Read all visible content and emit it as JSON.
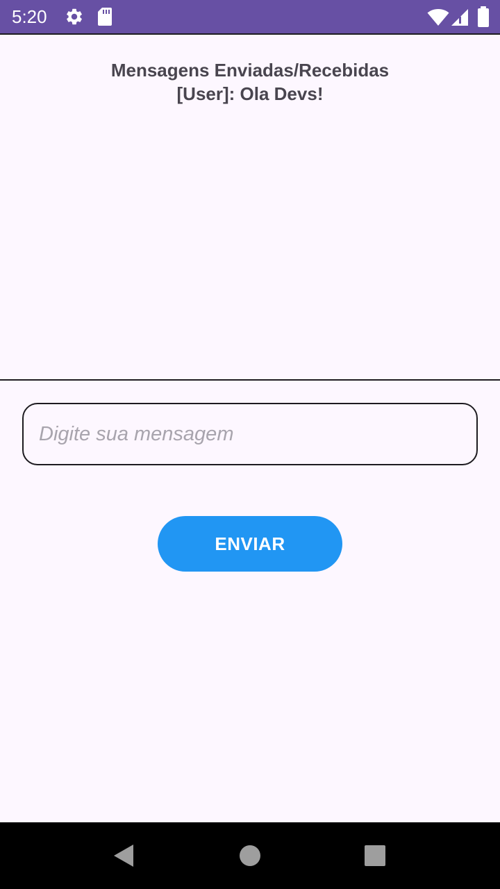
{
  "status_bar": {
    "time": "5:20",
    "icons": [
      "settings-icon",
      "sd-card-icon",
      "wifi-icon",
      "signal-icon",
      "battery-icon"
    ],
    "background_color": "#6750a4"
  },
  "main": {
    "title": "Mensagens Enviadas/Recebidas",
    "messages": [
      "[User]: Ola Devs!"
    ],
    "input": {
      "placeholder": "Digite sua mensagem",
      "value": ""
    },
    "send_label": "ENVIAR",
    "send_color": "#2196f3"
  },
  "nav_bar": {
    "buttons": [
      "back-icon",
      "home-icon",
      "recents-icon"
    ]
  }
}
